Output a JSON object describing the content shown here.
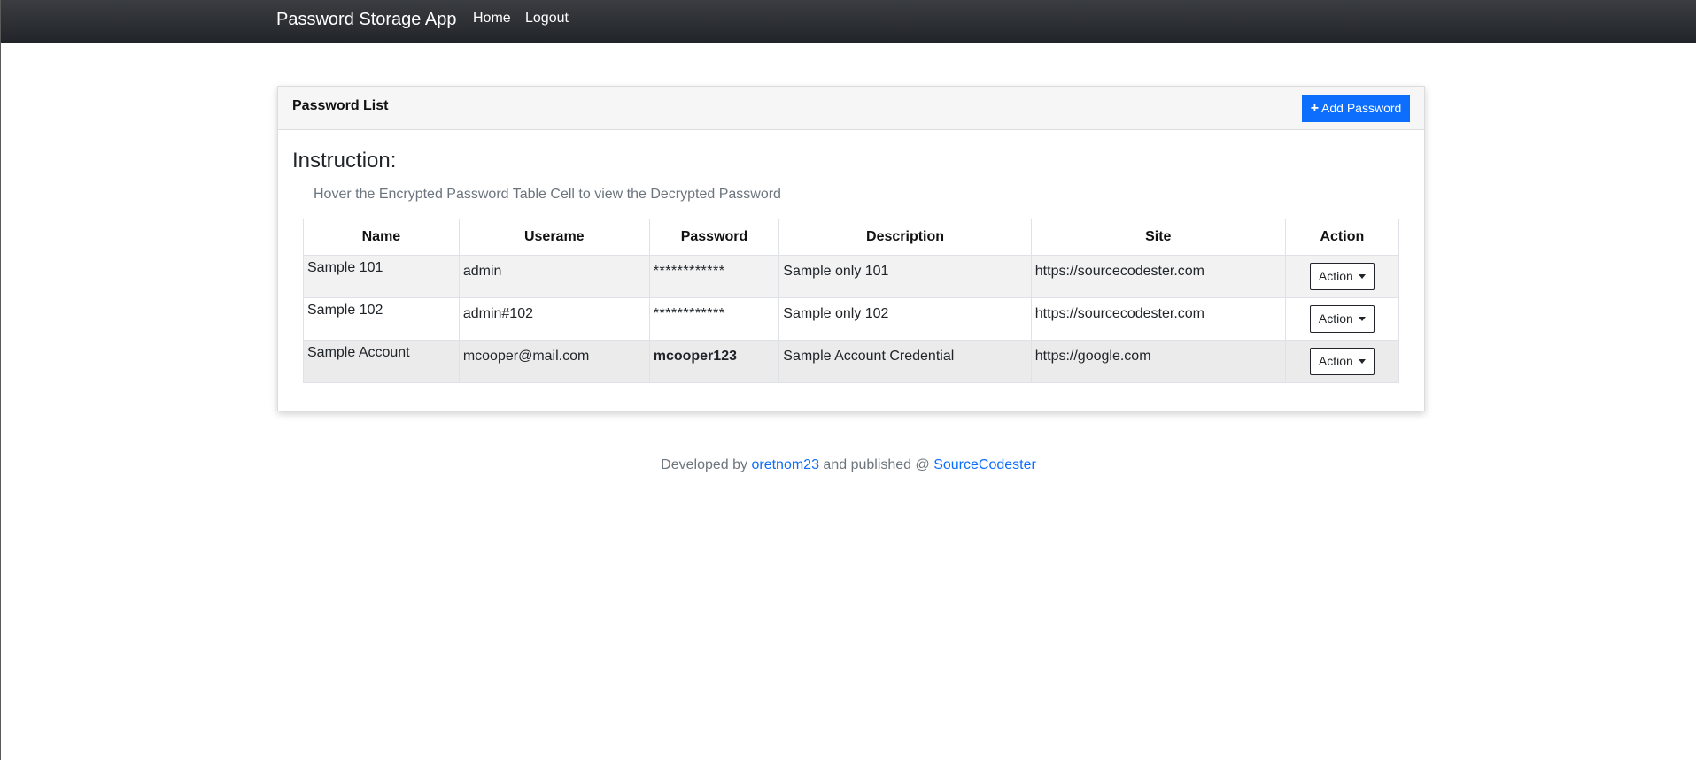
{
  "navbar": {
    "brand": "Password Storage App",
    "links": [
      "Home",
      "Logout"
    ]
  },
  "card": {
    "title": "Password List",
    "add_button": "Add Password",
    "instruction_title": "Instruction:",
    "instruction_text": "Hover the Encrypted Password Table Cell to view the Decrypted Password"
  },
  "table": {
    "headers": [
      "Name",
      "Userame",
      "Password",
      "Description",
      "Site",
      "Action"
    ],
    "rows": [
      {
        "name": "Sample 101",
        "username": "admin",
        "password": "************",
        "description": "Sample only 101",
        "site": "https://sourcecodester.com",
        "action": "Action"
      },
      {
        "name": "Sample 102",
        "username": "admin#102",
        "password": "************",
        "description": "Sample only 102",
        "site": "https://sourcecodester.com",
        "action": "Action"
      },
      {
        "name": "Sample Account",
        "username": "mcooper@mail.com",
        "password": "mcooper123",
        "description": "Sample Account Credential",
        "site": "https://google.com",
        "action": "Action"
      }
    ]
  },
  "footer": {
    "prefix": "Developed by",
    "author": "oretnom23",
    "middle": "and published @",
    "publisher": "SourceCodester"
  },
  "colors": {
    "navbar": "#212428",
    "primary": "#0d6efd",
    "muted": "#6c757d"
  },
  "icons": {
    "add": "plus-icon",
    "dropdown": "caret-down-icon"
  }
}
